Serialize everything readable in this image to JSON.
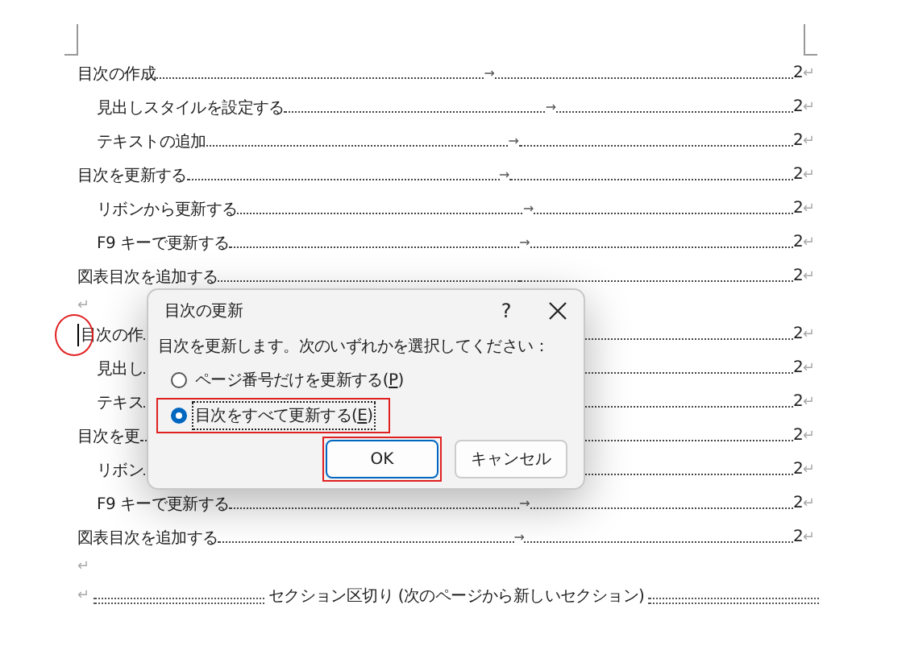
{
  "document": [
    {
      "kind": "toc",
      "entries": [
        {
          "text": "目次の作成",
          "tab": "→",
          "page": "2",
          "mark": "↵",
          "cursor": false,
          "children": [
            {
              "text": "見出しスタイルを設定する",
              "tab": "→",
              "page": "2",
              "mark": "↵",
              "cursor": false
            },
            {
              "text": "テキストの追加",
              "tab": "→",
              "page": "2",
              "mark": "↵",
              "cursor": false
            }
          ]
        },
        {
          "text": "目次を更新する",
          "tab": "→",
          "page": "2",
          "mark": "↵",
          "cursor": false,
          "children": [
            {
              "text": "リボンから更新する",
              "tab": "→",
              "page": "2",
              "mark": "↵",
              "cursor": false
            },
            {
              "text": "F9 キーで更新する",
              "tab": "→",
              "page": "2",
              "mark": "↵",
              "cursor": false
            }
          ]
        },
        {
          "text": "図表目次を追加する",
          "page": "2",
          "mark": "↵",
          "cursor": false
        }
      ]
    },
    {
      "kind": "empty",
      "mark": "↵"
    },
    {
      "kind": "toc",
      "entries": [
        {
          "text": "目次の作",
          "page": "2",
          "mark": "↵",
          "cursor": true,
          "children": [
            {
              "text": "見出し",
              "page": "2",
              "mark": "↵",
              "cursor": false
            },
            {
              "text": "テキス",
              "page": "2",
              "mark": "↵",
              "cursor": false
            }
          ]
        },
        {
          "text": "目次を更",
          "page": "2",
          "mark": "↵",
          "cursor": false,
          "children": [
            {
              "text": "リボン",
              "page": "2",
              "mark": "↵",
              "cursor": false
            },
            {
              "text": "F9 キーで更新する",
              "tab": "→",
              "page": "2",
              "mark": "↵",
              "cursor": false
            }
          ]
        },
        {
          "text": "図表目次を追加する",
          "tab": "→",
          "page": "2",
          "mark": "↵",
          "cursor": false
        }
      ]
    },
    {
      "kind": "empty",
      "mark": "↵"
    },
    {
      "kind": "section_break",
      "mark": "↵",
      "text": "セクション区切り (次のページから新しいセクション)"
    }
  ],
  "dialog": {
    "title": "目次の更新",
    "help": "?",
    "message": "目次を更新します。次のいずれかを選択してください：",
    "options": [
      {
        "label_before": "ページ番号だけを更新する(",
        "access_key": "P",
        "label_after": ")",
        "selected": false,
        "focused": false,
        "highlighted": false
      },
      {
        "label_before": "目次をすべて更新する(",
        "access_key": "E",
        "label_after": ")",
        "selected": true,
        "focused": true,
        "highlighted": true
      }
    ],
    "buttons": [
      {
        "label": "OK",
        "default": true,
        "highlighted": true
      },
      {
        "label": "キャンセル",
        "default": false,
        "highlighted": false
      }
    ]
  }
}
